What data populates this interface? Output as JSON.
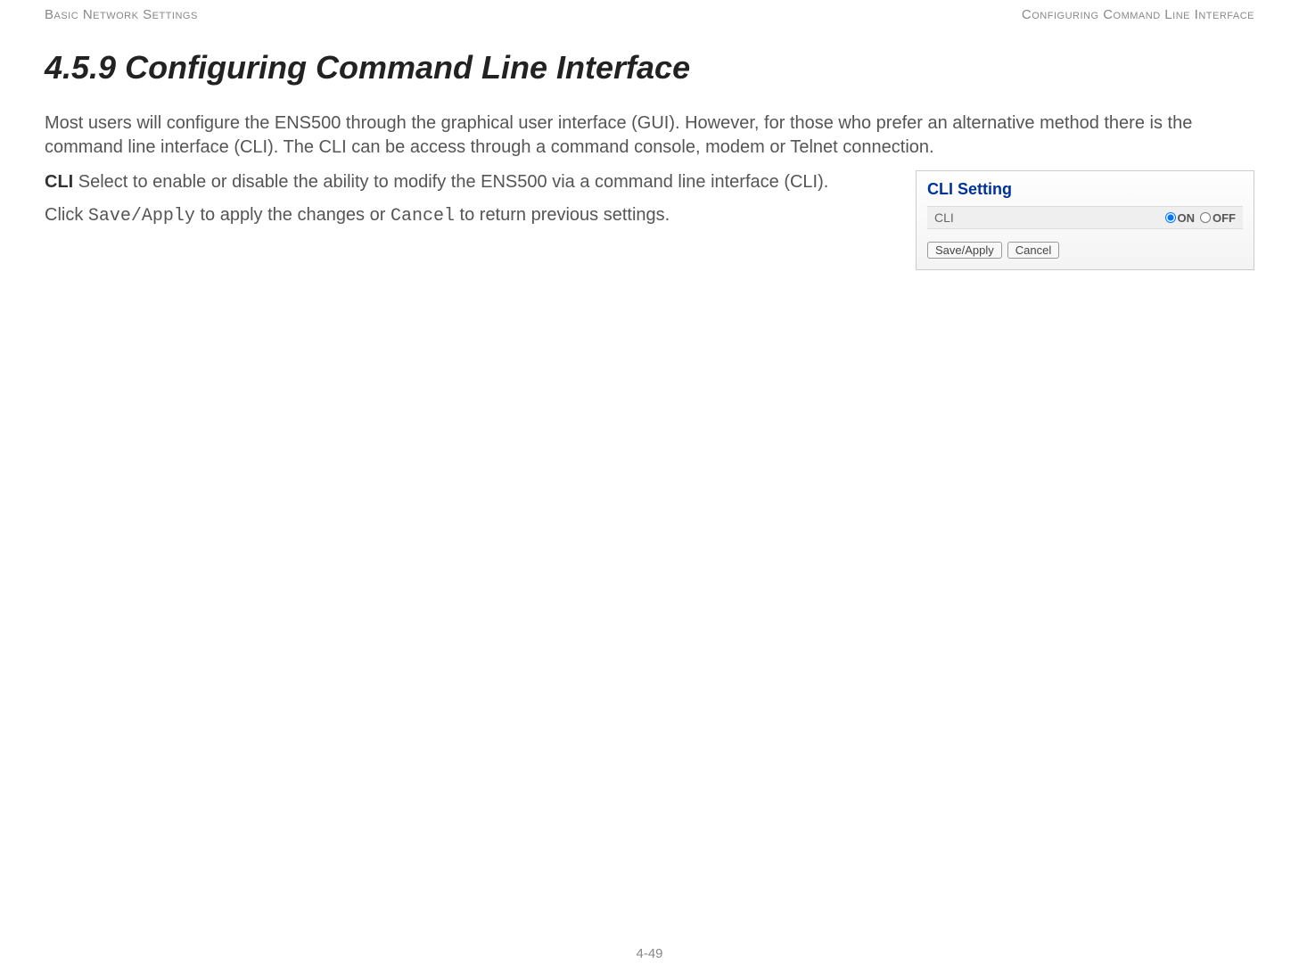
{
  "header": {
    "left": "Basic Network Settings",
    "right": "Configuring Command Line Interface"
  },
  "section": {
    "title": "4.5.9 Configuring Command Line Interface",
    "intro": "Most users will configure the ENS500 through the graphical user interface (GUI). However, for those who prefer an alternative method there is the command line interface (CLI).  The CLI can be access through a command console, modem or Telnet connection.",
    "cli_label": "CLI",
    "cli_text": "  Select to enable or disable the ability to modify the ENS500 via a command line interface (CLI).",
    "click_pre": "Click ",
    "save_apply_mono": "Save/Apply",
    "click_mid": " to apply the changes or ",
    "cancel_mono": "Cancel",
    "click_post": " to return previous settings."
  },
  "panel": {
    "title": "CLI Setting",
    "row_label": "CLI",
    "radio_on": "ON",
    "radio_off": "OFF",
    "save_button": "Save/Apply",
    "cancel_button": "Cancel",
    "selected": "on"
  },
  "footer": {
    "page": "4-49"
  }
}
